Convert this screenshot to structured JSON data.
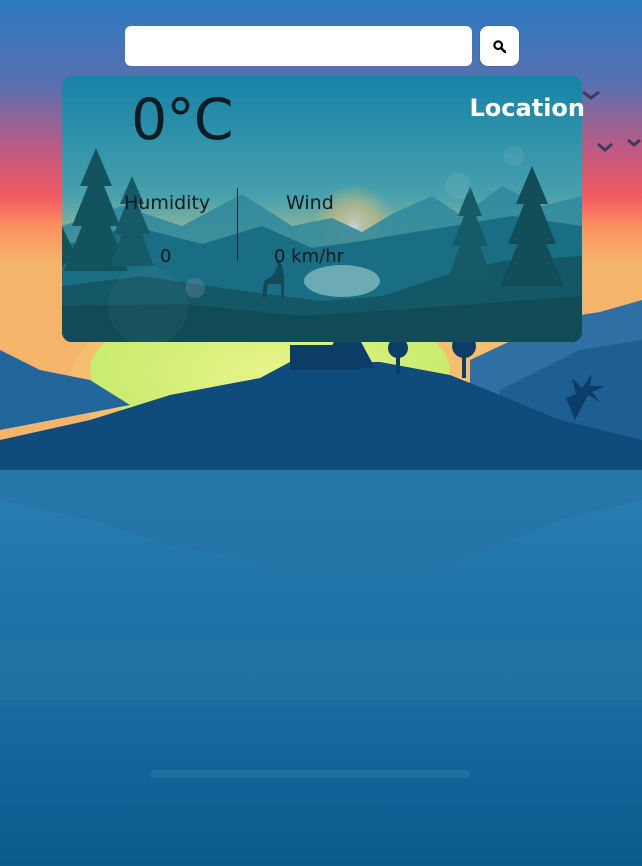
{
  "search": {
    "placeholder": "",
    "value": ""
  },
  "weather": {
    "temperature": "0°C",
    "location": "Location",
    "humidity_label": "Humidity",
    "humidity_value": "0",
    "wind_label": "Wind",
    "wind_value": "0 km/hr"
  },
  "icons": {
    "search_button": "search-icon"
  }
}
